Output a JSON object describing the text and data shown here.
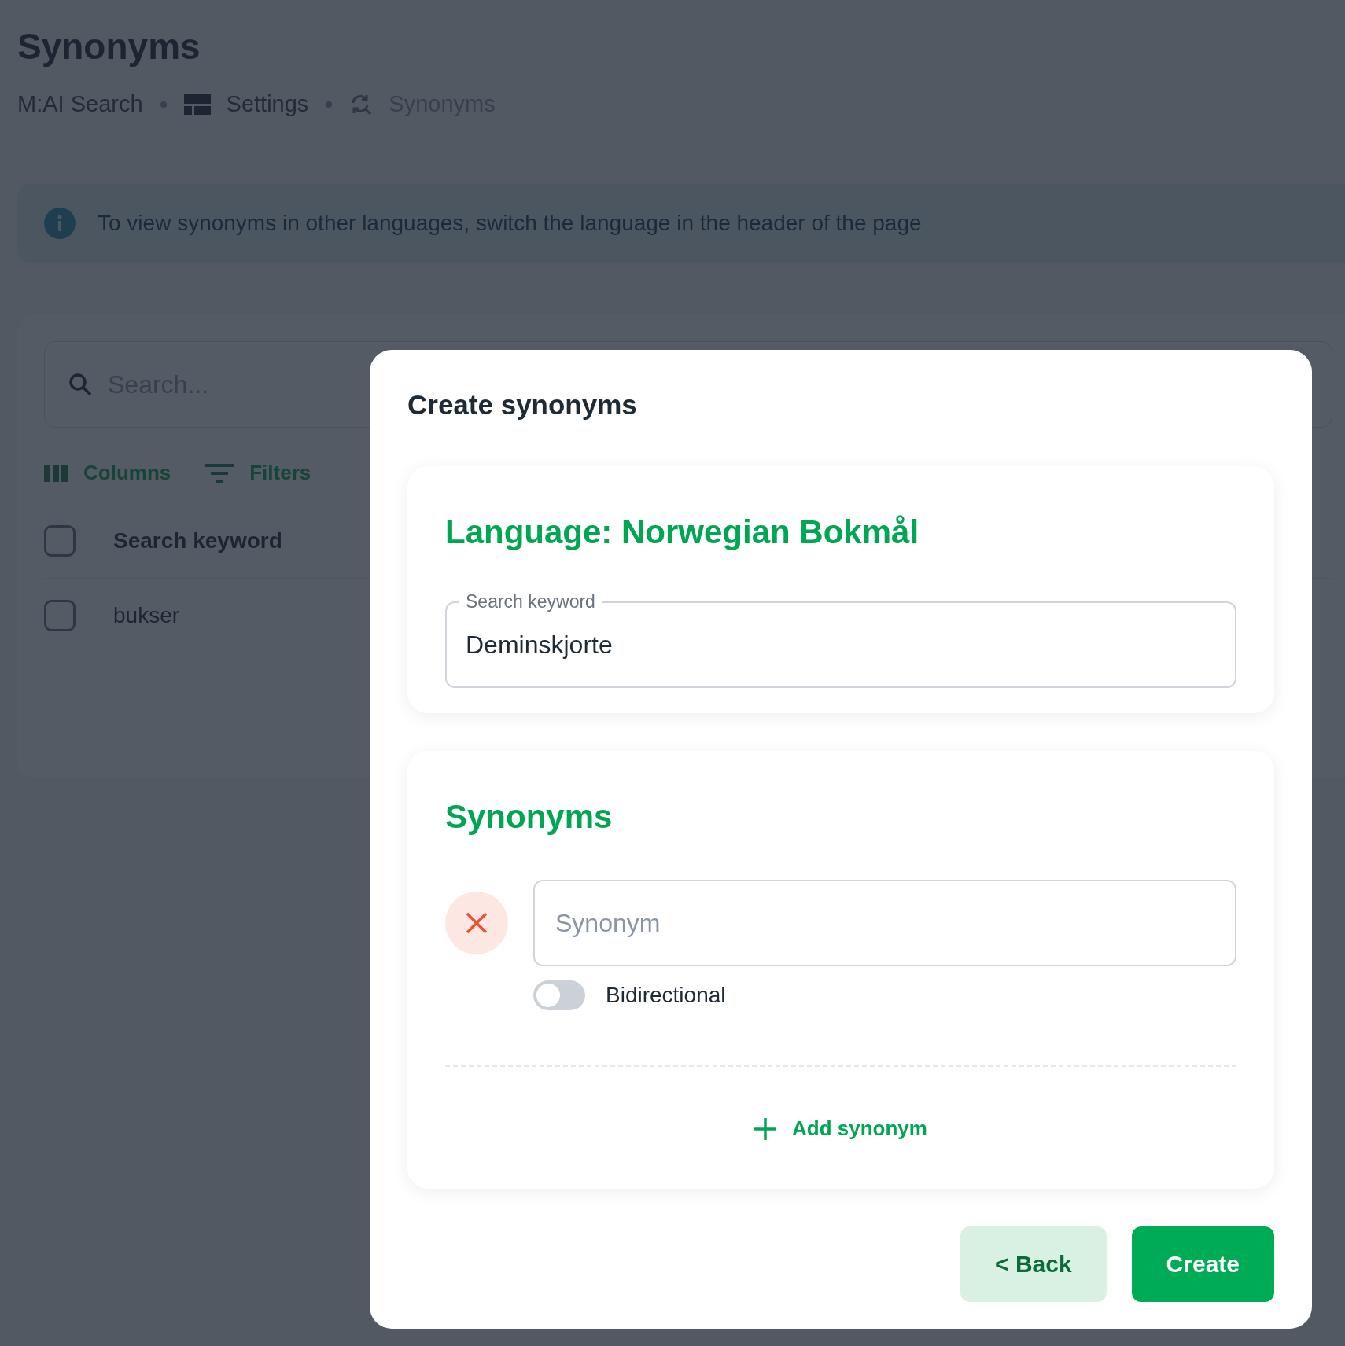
{
  "page": {
    "title": "Synonyms",
    "breadcrumbs": [
      {
        "label": "M:AI Search",
        "kind": "plain",
        "current": false
      },
      {
        "label": "Settings",
        "kind": "layout",
        "current": false
      },
      {
        "label": "Synonyms",
        "kind": "sync",
        "current": true
      }
    ],
    "info": "To view synonyms in other languages, switch the language in the header of the page",
    "table": {
      "search_placeholder": "Search...",
      "toolbar": [
        {
          "label": "Columns",
          "kind": "columns"
        },
        {
          "label": "Filters",
          "kind": "filter"
        }
      ],
      "header": {
        "label": "Search keyword",
        "checked": false
      },
      "rows": [
        {
          "label": "bukser",
          "checked": false
        }
      ]
    }
  },
  "modal": {
    "title": "Create synonyms",
    "language_heading": "Language: Norwegian Bokmål",
    "keyword": {
      "label": "Search keyword",
      "value": "Deminskjorte"
    },
    "synonyms_heading": "Synonyms",
    "synonyms": [
      {
        "placeholder": "Synonym",
        "bidirectional": false,
        "bidirectional_label": "Bidirectional"
      }
    ],
    "add_label": "Add synonym",
    "buttons": [
      {
        "label": "< Back",
        "kind": "secondary"
      },
      {
        "label": "Create",
        "kind": "primary"
      }
    ]
  }
}
